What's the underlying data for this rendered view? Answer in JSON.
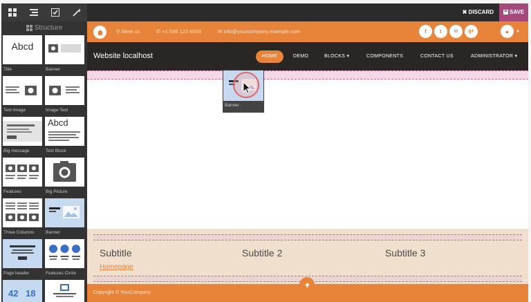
{
  "editor": {
    "sidebar_title": "Structure",
    "snippets": [
      {
        "label": "Title",
        "thumb_text": "Abcd",
        "icon": "title-thumb"
      },
      {
        "label": "Banner",
        "icon": "banner-thumb"
      },
      {
        "label": "Text-Image",
        "icon": "text-image-thumb"
      },
      {
        "label": "Image-Text",
        "icon": "image-text-thumb"
      },
      {
        "label": "Big message",
        "icon": "big-message-thumb"
      },
      {
        "label": "Text Block",
        "thumb_text": "Abcd",
        "icon": "text-block-thumb"
      },
      {
        "label": "Features",
        "icon": "features-thumb"
      },
      {
        "label": "Big Picture",
        "icon": "big-picture-thumb"
      },
      {
        "label": "Three Columns",
        "icon": "three-columns-thumb"
      },
      {
        "label": "Banner",
        "icon": "banner-thumb-selected"
      },
      {
        "label": "Page header",
        "icon": "page-header-thumb"
      },
      {
        "label": "Features Circle",
        "icon": "features-circle-thumb"
      },
      {
        "thumb_text": "42",
        "thumb_text2": "18",
        "icon": "counters-thumb"
      }
    ],
    "discard_label": "DISCARD",
    "save_label": "SAVE",
    "dragging_label": "Banner"
  },
  "site": {
    "contact": {
      "meet": "Meet us",
      "phone": "+1 555 123 8069",
      "email": "info@yourcompany.example.com"
    },
    "social": [
      "f",
      "t",
      "in",
      "g+"
    ],
    "brand": "Website localhost",
    "nav": [
      {
        "label": "HOME",
        "active": true
      },
      {
        "label": "DEMO"
      },
      {
        "label": "BLOCKS ▾"
      },
      {
        "label": "COMPONENTS"
      },
      {
        "label": "CONTACT US"
      },
      {
        "label": "ADMINISTRATOR ▾"
      }
    ],
    "subtitles": [
      "Subtitle",
      "Subtitle 2",
      "Subtitle 3"
    ],
    "homepage_link": "Homepage",
    "footer": "Copyright © YourCompany"
  },
  "colors": {
    "accent": "#e8833a",
    "navbar": "#2a2624",
    "save": "#a5497d",
    "sidebar": "#333333",
    "drop_zone": "#c46aa0"
  }
}
